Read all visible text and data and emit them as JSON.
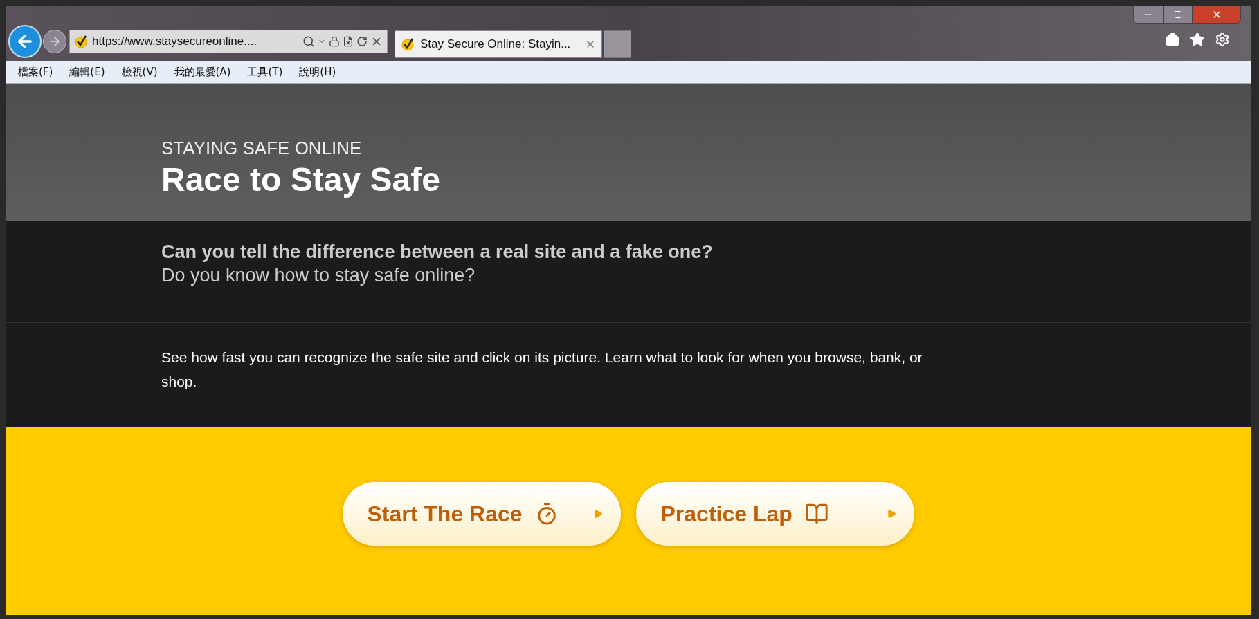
{
  "browser": {
    "address": "https://www.staysecureonline....",
    "tabs": [
      {
        "title": "Stay Secure Online: Stayin...",
        "selected": true
      }
    ]
  },
  "menu_bar": [
    "檔案(F)",
    "編輯(E)",
    "檢視(V)",
    "我的最愛(A)",
    "工具(T)",
    "說明(H)"
  ],
  "header": {
    "eyebrow": "STAYING SAFE ONLINE",
    "title": "Race to Stay Safe"
  },
  "intro": {
    "question": "Can you tell the difference between a real site and a fake one?",
    "subtitle": "Do you know how to stay safe online?"
  },
  "description": "See how fast you can recognize the safe site and click on its picture. Learn what to look for when you browse, bank, or shop.",
  "buttons": [
    {
      "label": "Start The Race",
      "kind": "timer"
    },
    {
      "label": "Practice Lap",
      "kind": "book"
    }
  ]
}
